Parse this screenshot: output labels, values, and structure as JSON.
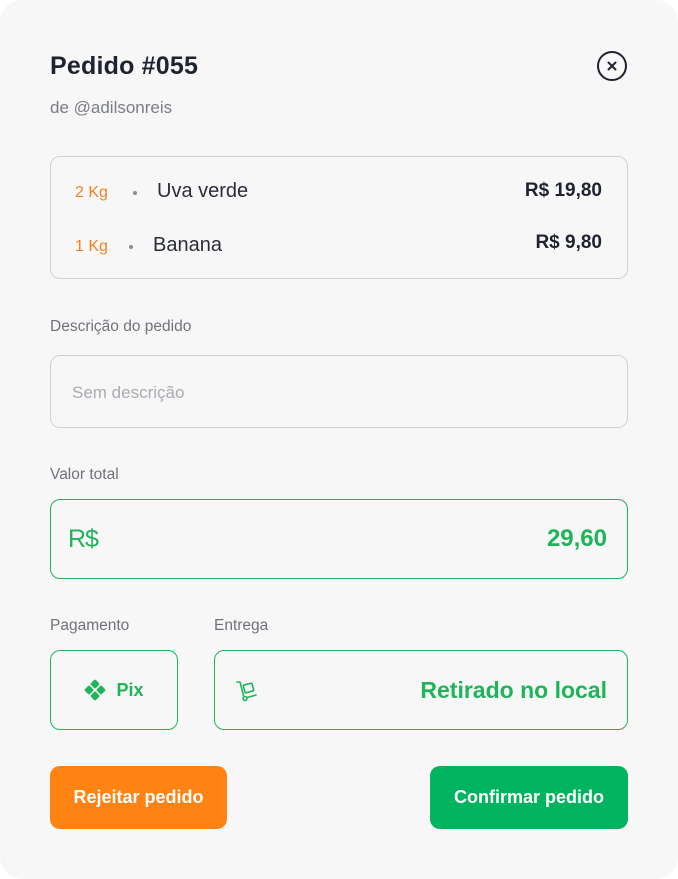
{
  "order": {
    "title": "Pedido #055",
    "customer": "de @adilsonreis"
  },
  "items": [
    {
      "qty": "2 Kg",
      "name": "Uva verde",
      "price": "R$ 19,80"
    },
    {
      "qty": "1 Kg",
      "name": "Banana",
      "price": "R$ 9,80"
    }
  ],
  "description": {
    "label": "Descrição do pedido",
    "placeholder": "Sem descrição",
    "value": ""
  },
  "total": {
    "label": "Valor total",
    "currency": "R$",
    "value": "29,60"
  },
  "payment": {
    "label": "Pagamento",
    "method": "Pix",
    "icon": "pix-icon"
  },
  "delivery": {
    "label": "Entrega",
    "method": "Retirado no local",
    "icon": "hand-truck-icon"
  },
  "actions": {
    "reject": "Rejeitar pedido",
    "confirm": "Confirmar pedido"
  },
  "colors": {
    "accent_green": "#1fb45a",
    "confirm_green": "#00b35e",
    "reject_orange": "#fe8313",
    "qty_orange": "#f5821f",
    "background": "#f7f7f7"
  }
}
